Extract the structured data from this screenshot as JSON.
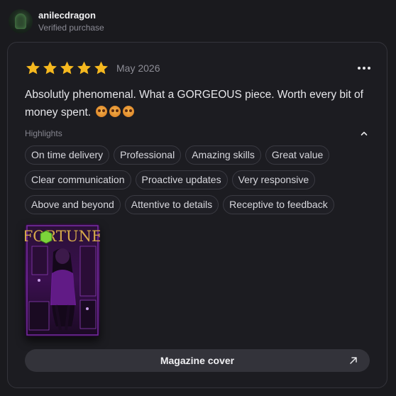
{
  "reviewer": {
    "username": "anilecdragon",
    "verified_label": "Verified purchase"
  },
  "review": {
    "rating": 5,
    "max_rating": 5,
    "date": "May 2026",
    "text": "Absolutly phenomenal. What a GORGEOUS piece. Worth every bit of money spent.",
    "emojis": [
      "star-struck-emoji",
      "star-struck-emoji",
      "star-struck-emoji"
    ]
  },
  "highlights": {
    "title": "Highlights",
    "rows": [
      [
        "On time delivery",
        "Professional",
        "Amazing skills",
        "Great value"
      ],
      [
        "Clear communication",
        "Proactive updates",
        "Very responsive"
      ],
      [
        "Above and beyond",
        "Attentive to details",
        "Receptive to feedback"
      ]
    ]
  },
  "attachment": {
    "cover_title": "FORTUNE",
    "button_label": "Magazine cover"
  },
  "colors": {
    "star": "#f5b81f",
    "background": "#1a1a1e",
    "card_border": "#34343b",
    "chip_border": "#3a3a42",
    "button_bg": "#33333a",
    "cover_accent": "#b23cff"
  },
  "icons": {
    "more": "more-horizontal-icon",
    "collapse": "chevron-up-icon",
    "open": "arrow-up-right-icon"
  }
}
